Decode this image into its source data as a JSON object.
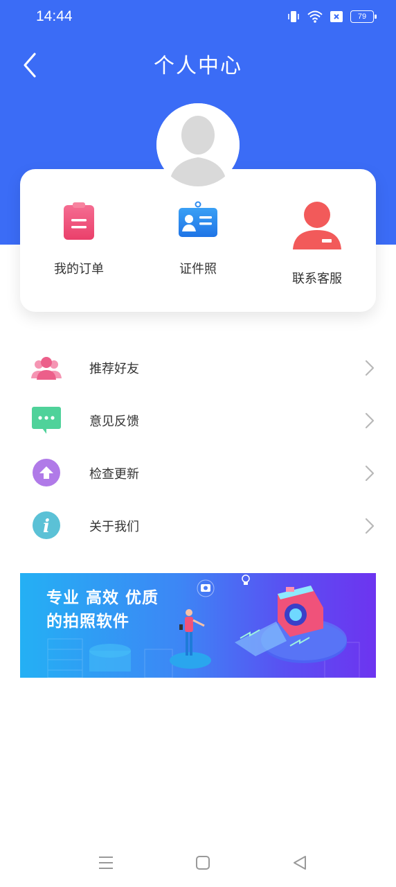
{
  "status_bar": {
    "time": "14:44",
    "battery": "79"
  },
  "header": {
    "title": "个人中心"
  },
  "quick_actions": [
    {
      "label": "我的订单",
      "icon": "clipboard-icon",
      "color": "#f0527a"
    },
    {
      "label": "证件照",
      "icon": "id-card-icon",
      "color": "#2f8cf0"
    },
    {
      "label": "联系客服",
      "icon": "customer-service-icon",
      "color": "#f25a5a"
    }
  ],
  "menu": [
    {
      "label": "推荐好友",
      "icon": "users-icon",
      "color": "#f0709a"
    },
    {
      "label": "意见反馈",
      "icon": "chat-icon",
      "color": "#4fd29a"
    },
    {
      "label": "检查更新",
      "icon": "upload-arrow-icon",
      "color": "#b07ae8"
    },
    {
      "label": "关于我们",
      "icon": "info-icon",
      "color": "#5bc1d6"
    }
  ],
  "banner": {
    "line1": "专业 高效 优质",
    "line2": "的拍照软件"
  },
  "colors": {
    "accent": "#3b6cf6"
  }
}
